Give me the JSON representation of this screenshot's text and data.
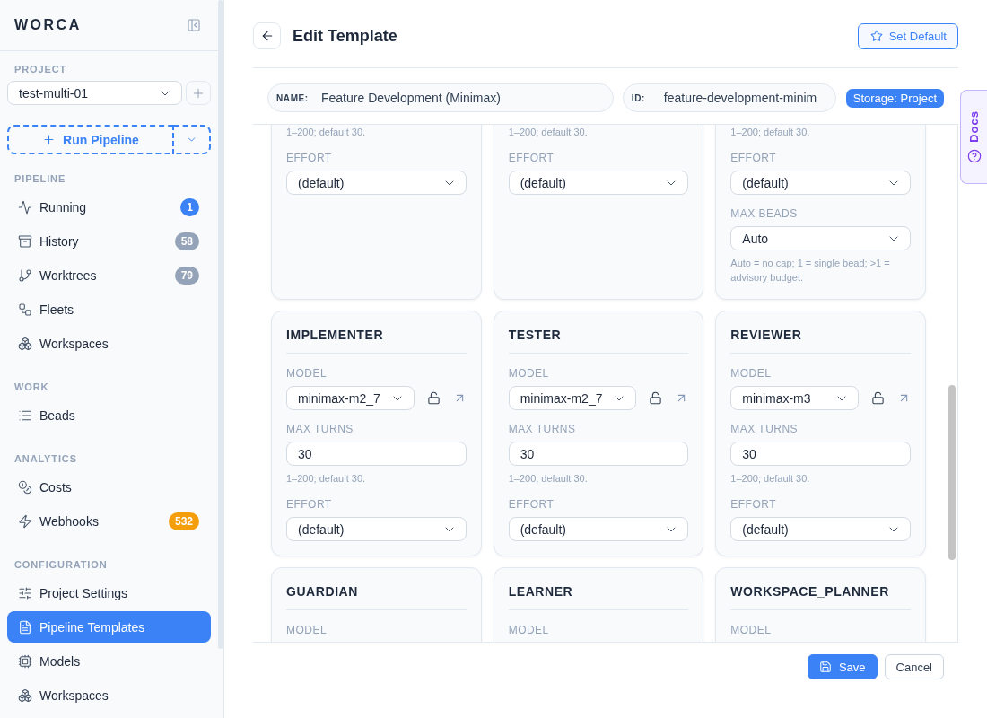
{
  "sidebar": {
    "brand": "WORCA",
    "project": {
      "label": "PROJECT",
      "value": "test-multi-01"
    },
    "run_button": "Run Pipeline",
    "sections": [
      {
        "title": "PIPELINE",
        "items": [
          {
            "label": "Running",
            "selected": false,
            "badge": {
              "text": "1",
              "color": "#3b82f6"
            }
          },
          {
            "label": "History",
            "selected": false,
            "badge": {
              "text": "58",
              "color": "#94a3b8"
            }
          },
          {
            "label": "Worktrees",
            "selected": false,
            "badge": {
              "text": "79",
              "color": "#94a3b8"
            }
          },
          {
            "label": "Fleets",
            "selected": false
          },
          {
            "label": "Workspaces",
            "selected": false
          }
        ]
      },
      {
        "title": "WORK",
        "items": [
          {
            "label": "Beads",
            "selected": false
          }
        ]
      },
      {
        "title": "ANALYTICS",
        "items": [
          {
            "label": "Costs",
            "selected": false
          },
          {
            "label": "Webhooks",
            "selected": false,
            "badge": {
              "text": "532",
              "color": "#f59e0b"
            }
          }
        ]
      },
      {
        "title": "CONFIGURATION",
        "items": [
          {
            "label": "Project Settings",
            "selected": false
          },
          {
            "label": "Pipeline Templates",
            "selected": true
          },
          {
            "label": "Models",
            "selected": false
          },
          {
            "label": "Workspaces",
            "selected": false
          }
        ]
      }
    ]
  },
  "header": {
    "title": "Edit Template",
    "set_default_button": "Set Default"
  },
  "meta": {
    "name_label": "NAME:",
    "name_value": "Feature Development (Minimax)",
    "id_label": "ID:",
    "id_value": "feature-development-minim",
    "storage_badge": "Storage: Project"
  },
  "docs_tab": {
    "label": "Docs"
  },
  "template_cards": [
    {
      "fields": [
        {
          "kind": "hint",
          "text": "1–200; default 30."
        },
        {
          "kind": "select",
          "label": "EFFORT",
          "value": "(default)"
        }
      ]
    },
    {
      "fields": [
        {
          "kind": "hint",
          "text": "1–200; default 30."
        },
        {
          "kind": "select",
          "label": "EFFORT",
          "value": "(default)"
        }
      ]
    },
    {
      "fields": [
        {
          "kind": "hint",
          "text": "1–200; default 30."
        },
        {
          "kind": "select",
          "label": "EFFORT",
          "value": "(default)"
        },
        {
          "kind": "select",
          "label": "MAX BEADS",
          "value": "Auto",
          "hint": "Auto = no cap; 1 = single bead; >1 = advisory budget."
        }
      ]
    },
    {
      "title": "IMPLEMENTER",
      "fields": [
        {
          "kind": "model",
          "label": "MODEL",
          "value": "minimax-m2_7",
          "locked": false
        },
        {
          "kind": "number",
          "label": "MAX TURNS",
          "value": "30",
          "hint": "1–200; default 30."
        },
        {
          "kind": "select",
          "label": "EFFORT",
          "value": "(default)"
        }
      ]
    },
    {
      "title": "TESTER",
      "fields": [
        {
          "kind": "model",
          "label": "MODEL",
          "value": "minimax-m2_7",
          "locked": false
        },
        {
          "kind": "number",
          "label": "MAX TURNS",
          "value": "30",
          "hint": "1–200; default 30."
        },
        {
          "kind": "select",
          "label": "EFFORT",
          "value": "(default)"
        }
      ]
    },
    {
      "title": "REVIEWER",
      "fields": [
        {
          "kind": "model",
          "label": "MODEL",
          "value": "minimax-m3",
          "locked": false
        },
        {
          "kind": "number",
          "label": "MAX TURNS",
          "value": "30",
          "hint": "1–200; default 30."
        },
        {
          "kind": "select",
          "label": "EFFORT",
          "value": "(default)"
        }
      ]
    },
    {
      "title": "GUARDIAN",
      "fields": [
        {
          "kind": "label",
          "label": "MODEL"
        }
      ]
    },
    {
      "title": "LEARNER",
      "fields": [
        {
          "kind": "label",
          "label": "MODEL"
        }
      ]
    },
    {
      "title": "WORKSPACE_PLANNER",
      "fields": [
        {
          "kind": "label",
          "label": "MODEL"
        }
      ]
    }
  ],
  "footer": {
    "save_button": "Save",
    "cancel_button": "Cancel"
  }
}
